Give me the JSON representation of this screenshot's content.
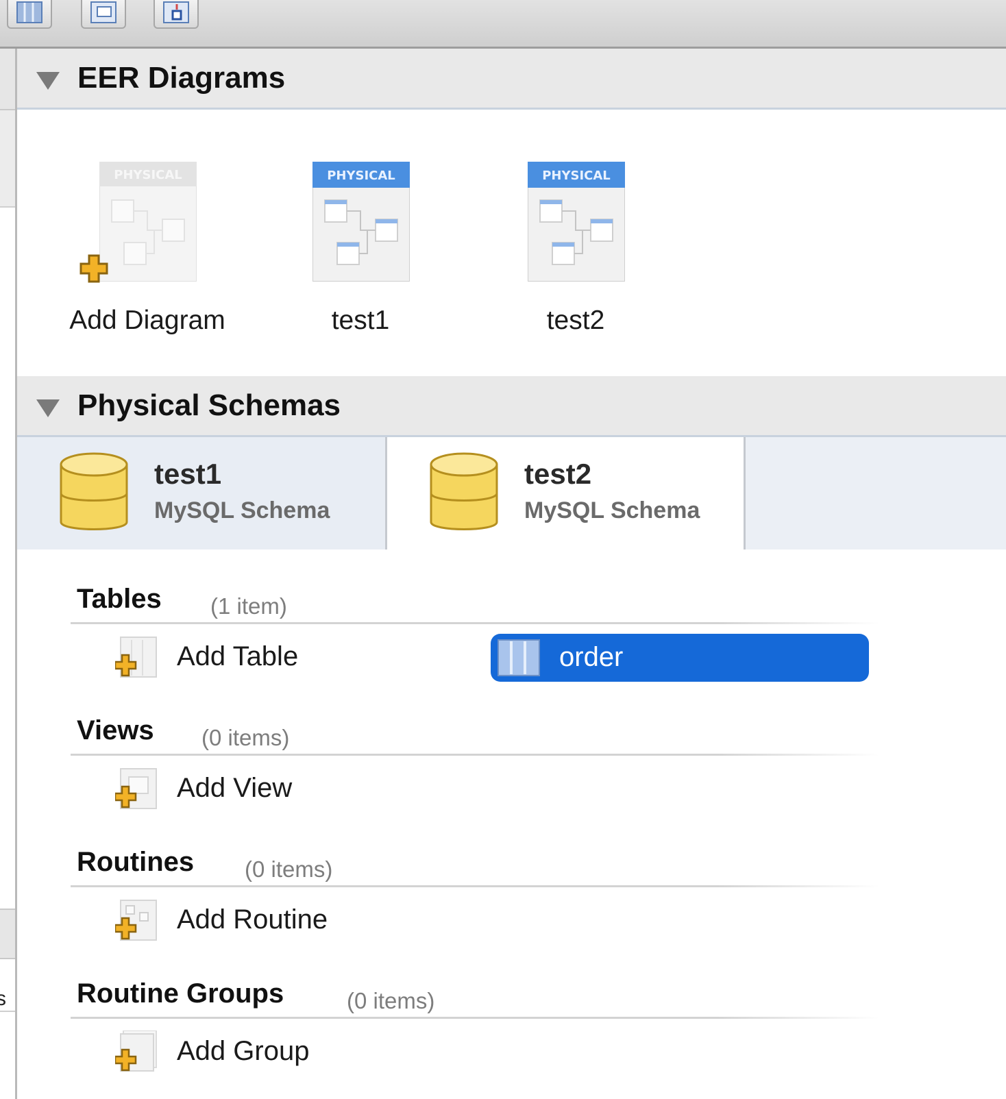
{
  "toolbar": {
    "buttons": [
      "table-tool",
      "view-tool",
      "routine-tool"
    ]
  },
  "eer_section": {
    "title": "EER Diagrams",
    "items": [
      {
        "label": "Add Diagram",
        "badge": "PHYSICAL"
      },
      {
        "label": "test1",
        "badge": "PHYSICAL"
      },
      {
        "label": "test2",
        "badge": "PHYSICAL"
      }
    ]
  },
  "schemas_section": {
    "title": "Physical Schemas",
    "tabs": [
      {
        "name": "test1",
        "type": "MySQL Schema"
      },
      {
        "name": "test2",
        "type": "MySQL Schema"
      }
    ]
  },
  "groups": {
    "tables": {
      "title": "Tables",
      "count": "(1 item)",
      "add_label": "Add Table",
      "items": [
        "order"
      ]
    },
    "views": {
      "title": "Views",
      "count": "(0 items)",
      "add_label": "Add View"
    },
    "routines": {
      "title": "Routines",
      "count": "(0 items)",
      "add_label": "Add Routine"
    },
    "routine_groups": {
      "title": "Routine Groups",
      "count": "(0 items)",
      "add_label": "Add Group"
    }
  },
  "left_strip": {
    "clipped_char": "s"
  },
  "colors": {
    "selection": "#1569d8",
    "plus": "#f2b227",
    "db": "#f5d65e",
    "diagram_header": "#4a8fe0"
  }
}
